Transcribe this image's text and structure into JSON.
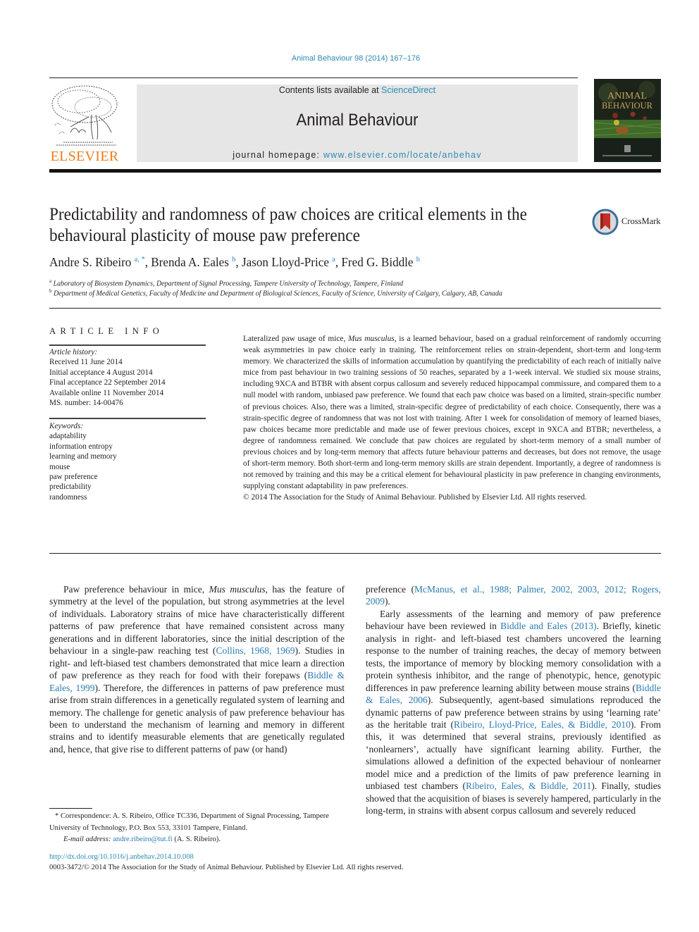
{
  "journal_ref": "Animal Behaviour 98 (2014) 167–176",
  "masthead": {
    "publisher_logo_text": "ELSEVIER",
    "contents_prefix": "Contents lists available at ",
    "contents_link": "ScienceDirect",
    "journal_title": "Animal Behaviour",
    "homepage_prefix": "journal homepage: ",
    "homepage_link": "www.elsevier.com/locate/anbehav",
    "cover_title_line1": "ANIMAL",
    "cover_title_line2": "BEHAVIOUR"
  },
  "article": {
    "title": "Predictability and randomness of paw choices are critical elements in the behavioural plasticity of mouse paw preference",
    "crossmark_label": "CrossMark",
    "authors": [
      {
        "name": "Andre S. Ribeiro",
        "sup": "a, *"
      },
      {
        "name": "Brenda A. Eales",
        "sup": "b"
      },
      {
        "name": "Jason Lloyd-Price",
        "sup": "a"
      },
      {
        "name": "Fred G. Biddle",
        "sup": "b"
      }
    ],
    "affiliations": [
      {
        "sup": "a",
        "text": "Laboratory of Biosystem Dynamics, Department of Signal Processing, Tampere University of Technology, Tampere, Finland"
      },
      {
        "sup": "b",
        "text": "Department of Medical Genetics, Faculty of Medicine and Department of Biological Sciences, Faculty of Science, University of Calgary, Calgary, AB, Canada"
      }
    ]
  },
  "article_info": {
    "heading": "ARTICLE INFO",
    "history_label": "Article history:",
    "history": [
      "Received 11 June 2014",
      "Initial acceptance 4 August 2014",
      "Final acceptance 22 September 2014",
      "Available online 11 November 2014",
      "MS. number: 14-00476"
    ],
    "keywords_label": "Keywords:",
    "keywords": [
      "adaptability",
      "information entropy",
      "learning and memory",
      "mouse",
      "paw preference",
      "predictability",
      "randomness"
    ]
  },
  "abstract": {
    "part1": "Lateralized paw usage of mice, ",
    "species": "Mus musculus",
    "part2": ", is a learned behaviour, based on a gradual reinforcement of randomly occurring weak asymmetries in paw choice early in training. The reinforcement relies on strain-dependent, short-term and long-term memory. We characterized the skills of information accumulation by quantifying the predictability of each reach of initially naïve mice from past behaviour in two training sessions of 50 reaches, separated by a 1-week interval. We studied six mouse strains, including 9XCA and BTBR with absent corpus callosum and severely reduced hippocampal commissure, and compared them to a null model with random, unbiased paw preference. We found that each paw choice was based on a limited, strain-specific number of previous choices. Also, there was a limited, strain-specific degree of predictability of each choice. Consequently, there was a strain-specific degree of randomness that was not lost with training. After 1 week for consolidation of memory of learned biases, paw choices became more predictable and made use of fewer previous choices, except in 9XCA and BTBR; nevertheless, a degree of randomness remained. We conclude that paw choices are regulated by short-term memory of a small number of previous choices and by long-term memory that affects future behaviour patterns and decreases, but does not remove, the usage of short-term memory. Both short-term and long-term memory skills are strain dependent. Importantly, a degree of randomness is not removed by training and this may be a critical element for behavioural plasticity in paw preference in changing environments, supplying constant adaptability in paw preferences.",
    "copyright": "© 2014 The Association for the Study of Animal Behaviour. Published by Elsevier Ltd. All rights reserved."
  },
  "body": {
    "left": {
      "p1_a": "Paw preference behaviour in mice, ",
      "p1_species": "Mus musculus",
      "p1_b": ", has the feature of symmetry at the level of the population, but strong asymmetries at the level of individuals. Laboratory strains of mice have characteristically different patterns of paw preference that have remained consistent across many generations and in different laboratories, since the initial description of the behaviour in a single-paw reaching test (",
      "cite1": "Collins, 1968, 1969",
      "p1_c": "). Studies in right- and left-biased test chambers demonstrated that mice learn a direction of paw preference as they reach for food with their forepaws (",
      "cite2": "Biddle & Eales, 1999",
      "p1_d": "). Therefore, the differences in patterns of paw preference must arise from strain differences in a genetically regulated system of learning and memory. The challenge for genetic analysis of paw preference behaviour has been to understand the mechanism of learning and memory in different strains and to identify measurable elements that are genetically regulated and, hence, that give rise to different patterns of paw (or hand)"
    },
    "right": {
      "p1_a": "preference (",
      "cite1": "McManus, et al., 1988; Palmer, 2002, 2003, 2012; Rogers, 2009",
      "p1_b": ").",
      "p2_a": "Early assessments of the learning and memory of paw preference behaviour have been reviewed in ",
      "cite2": "Biddle and Eales (2013)",
      "p2_b": ". Briefly, kinetic analysis in right- and left-biased test chambers uncovered the learning response to the number of training reaches, the decay of memory between tests, the importance of memory by blocking memory consolidation with a protein synthesis inhibitor, and the range of phenotypic, hence, genotypic differences in paw preference learning ability between mouse strains (",
      "cite3": "Biddle & Eales, 2006",
      "p2_c": "). Subsequently, agent-based simulations reproduced the dynamic patterns of paw preference between strains by using ‘learning rate’ as the heritable trait (",
      "cite4": "Ribeiro, Lloyd-Price, Eales, & Biddle, 2010",
      "p2_d": "). From this, it was determined that several strains, previously identified as ‘nonlearners’, actually have significant learning ability. Further, the simulations allowed a definition of the expected behaviour of nonlearner model mice and a prediction of the limits of paw preference learning in unbiased test chambers (",
      "cite5": "Ribeiro, Eales, & Biddle, 2011",
      "p2_e": "). Finally, studies showed that the acquisition of biases is severely hampered, particularly in the long-term, in strains with absent corpus callosum and severely reduced"
    }
  },
  "footnote": {
    "star_text": "* Correspondence: A. S. Ribeiro, Office TC336, Department of Signal Processing, Tampere University of Technology, P.O. Box 553, 33101 Tampere, Finland.",
    "email_label": "E-mail address: ",
    "email": "andre.ribeiro@tut.fi",
    "email_suffix": " (A. S. Ribeiro)."
  },
  "doi": "http://dx.doi.org/10.1016/j.anbehav.2014.10.008",
  "issn_copyright": "0003-3472/© 2014 The Association for the Study of Animal Behaviour. Published by Elsevier Ltd. All rights reserved.",
  "colors": {
    "link": "#2a7ab0",
    "elsevier_orange": "#f07c1b",
    "masthead_gray": "#e6e6e6",
    "text": "#231f20"
  }
}
